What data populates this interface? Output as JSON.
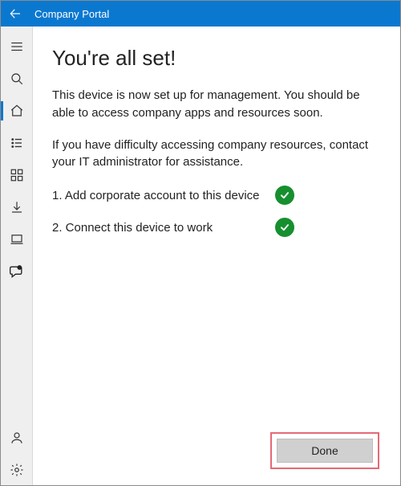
{
  "titlebar": {
    "title": "Company Portal"
  },
  "content": {
    "heading": "You're all set!",
    "para1": "This device is now set up for management.  You should be able to access company apps and resources soon.",
    "para2": "If you have difficulty accessing company resources, contact your IT administrator for assistance.",
    "steps": [
      {
        "label": "1. Add corporate account to this device",
        "done": true
      },
      {
        "label": "2. Connect this device to work",
        "done": true
      }
    ]
  },
  "footer": {
    "done_label": "Done"
  },
  "colors": {
    "accent": "#0b78d0",
    "success": "#168f2f",
    "highlight": "#e46a76"
  }
}
